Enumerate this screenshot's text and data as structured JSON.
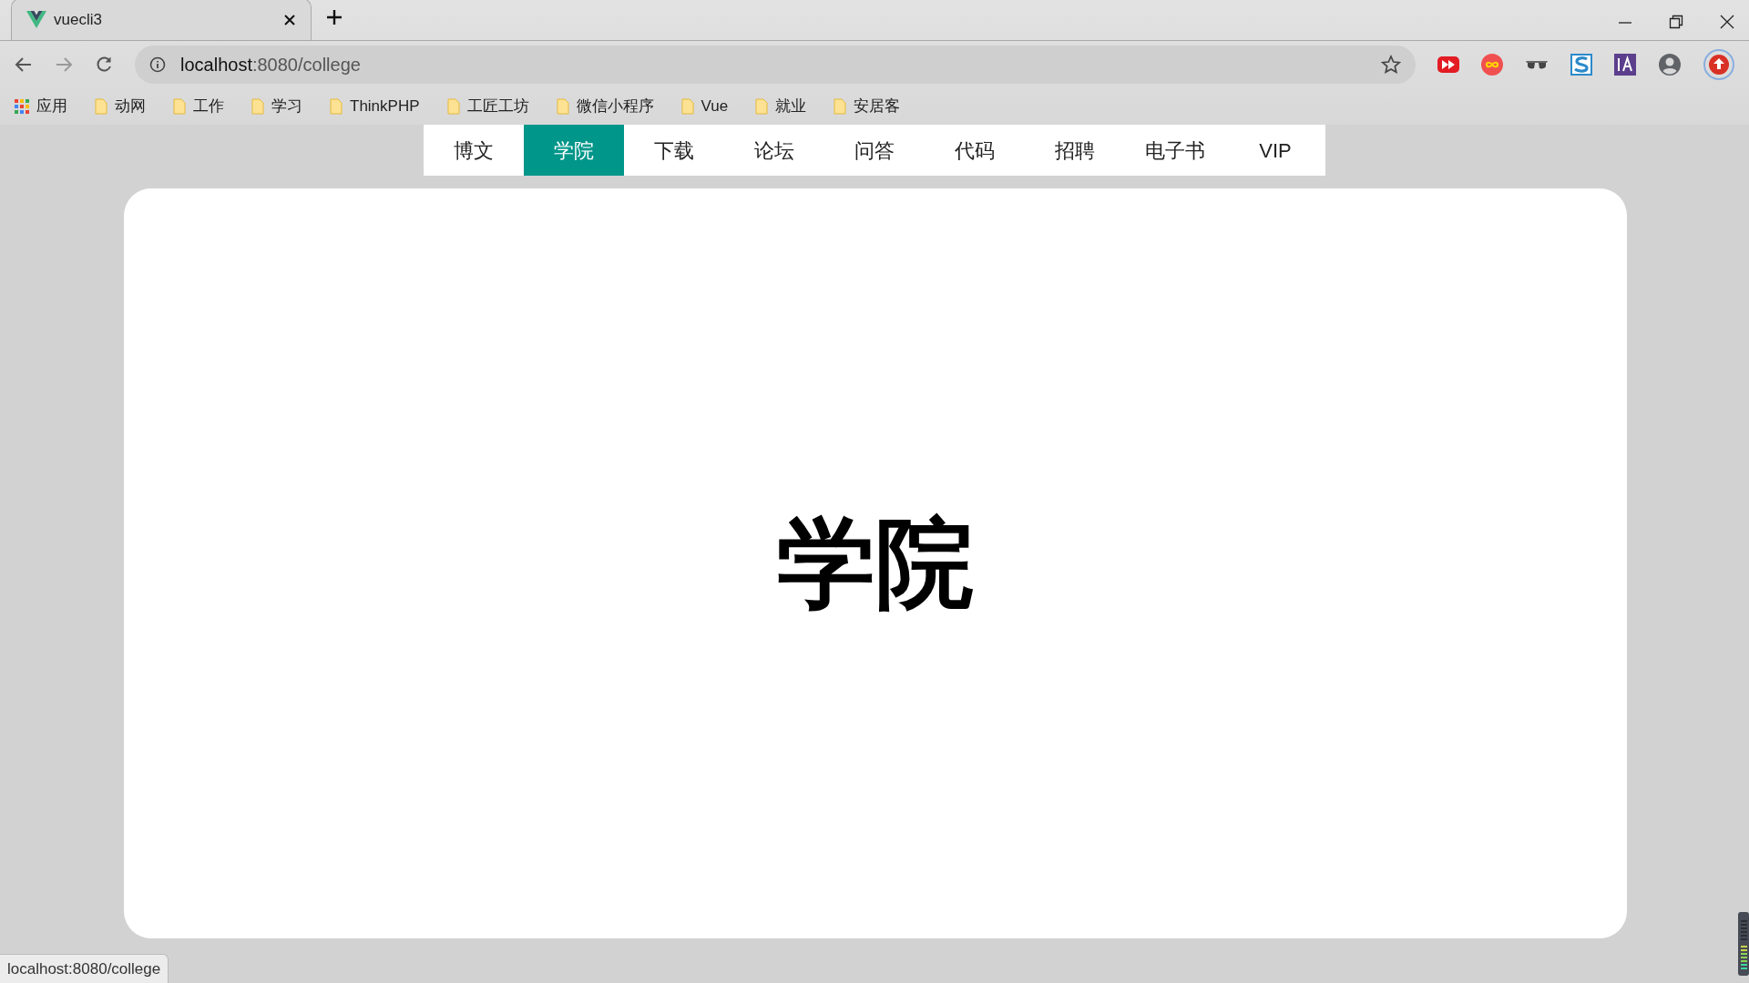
{
  "browser_tab": {
    "title": "vuecli3"
  },
  "address_bar": {
    "host": "localhost",
    "path": ":8080/college"
  },
  "bookmarks": [
    {
      "label": "应用",
      "kind": "apps"
    },
    {
      "label": "动网",
      "kind": "folder"
    },
    {
      "label": "工作",
      "kind": "folder"
    },
    {
      "label": "学习",
      "kind": "folder"
    },
    {
      "label": "ThinkPHP",
      "kind": "folder"
    },
    {
      "label": "工匠工坊",
      "kind": "folder"
    },
    {
      "label": "微信小程序",
      "kind": "folder"
    },
    {
      "label": "Vue",
      "kind": "folder"
    },
    {
      "label": "就业",
      "kind": "folder"
    },
    {
      "label": "安居客",
      "kind": "folder"
    }
  ],
  "nav": [
    {
      "label": "博文",
      "selected": false
    },
    {
      "label": "学院",
      "selected": true
    },
    {
      "label": "下载",
      "selected": false
    },
    {
      "label": "论坛",
      "selected": false
    },
    {
      "label": "问答",
      "selected": false
    },
    {
      "label": "代码",
      "selected": false
    },
    {
      "label": "招聘",
      "selected": false
    },
    {
      "label": "电子书",
      "selected": false
    },
    {
      "label": "VIP",
      "selected": false
    }
  ],
  "content": {
    "heading": "学院"
  },
  "status_bar": {
    "text": "localhost:8080/college"
  }
}
